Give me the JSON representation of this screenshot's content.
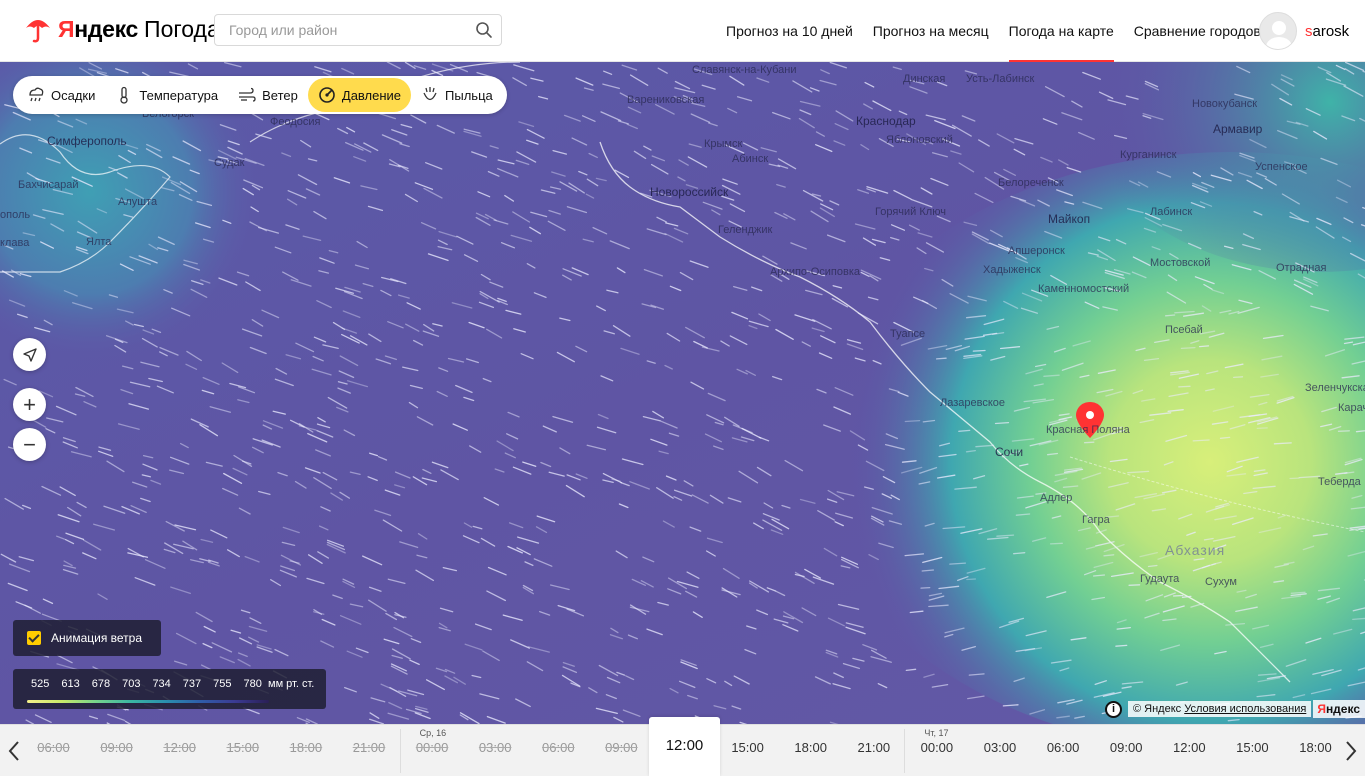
{
  "header": {
    "logo_brand_first": "Я",
    "logo_brand_rest": "ндекс",
    "logo_product": "Погода",
    "search_placeholder": "Город или район",
    "nav": [
      {
        "label": "Прогноз на 10 дней"
      },
      {
        "label": "Прогноз на месяц"
      },
      {
        "label": "Погода на карте"
      },
      {
        "label": "Сравнение городов"
      }
    ],
    "user_first": "s",
    "user_rest": "arosk"
  },
  "layers": [
    {
      "label": "Осадки",
      "icon": "precipitation-icon"
    },
    {
      "label": "Температура",
      "icon": "thermometer-icon"
    },
    {
      "label": "Ветер",
      "icon": "wind-icon"
    },
    {
      "label": "Давление",
      "icon": "pressure-icon",
      "active": true
    },
    {
      "label": "Пыльца",
      "icon": "pollen-icon"
    }
  ],
  "controls": {
    "zoom_in": "+",
    "zoom_out": "−"
  },
  "map": {
    "labels": {
      "simferopol": "Симферополь",
      "alushta": "Алушта",
      "yalta": "Ялта",
      "bakhchisaray": "Бахчисарай",
      "sevastopol": "ополь",
      "balaklava": "клава",
      "belogorsk": "Белогорск",
      "sudak": "Судак",
      "feodosia": "Феодосия",
      "varenikovskaya": "Варениковская",
      "slavyansk": "Славянск-на-Кубани",
      "dinskaya": "Динская",
      "ust_labinsk": "Усть-Лабинск",
      "novokubansk": "Новокубанск",
      "krasnodar": "Краснодар",
      "yablonovsky": "Яблоновский",
      "armavir": "Армавир",
      "krymsk": "Крымск",
      "abinsk": "Абинск",
      "novorossiysk": "Новороссийск",
      "kurganinsk": "Курганинск",
      "uspenskoe": "Успенское",
      "belorechensk": "Белореченск",
      "goryachy_klyuch": "Горячий Ключ",
      "maikop": "Майкоп",
      "labinsk": "Лабинск",
      "gelendzhik": "Геленджик",
      "dzhubga": "Джубга",
      "arkhipo": "Архипо-Осиповка",
      "apsheronsk": "Апшеронск",
      "khadyzhensk": "Хадыженск",
      "mostovskoy": "Мостовской",
      "otradnaya": "Отрадная",
      "kamennomostsky": "Каменномостский",
      "tuapse": "Туапсе",
      "pskhu": "Псебай",
      "zelenchukskaya": "Зеленчукская",
      "krasnaya_polyana": "Красная Поляна",
      "sochi": "Сочи",
      "lazarevskoe": "Лазаревское",
      "adler": "Адлер",
      "gagra": "Гагра",
      "abkhazia": "Абхазия",
      "gudauta": "Гудаута",
      "sukhum": "Сухум",
      "teberda": "Теберда",
      "karachaevsk": "Карача"
    }
  },
  "animation": {
    "label": "Анимация ветра",
    "checked": true
  },
  "legend": {
    "values": [
      "525",
      "613",
      "678",
      "703",
      "734",
      "737",
      "755",
      "780"
    ],
    "unit": "мм рт. ст."
  },
  "copyright": {
    "info": "i",
    "text": "© Яндекс",
    "terms": "Условия использования",
    "logo_first": "Я",
    "logo_rest": "ндекс"
  },
  "timeline": {
    "items": [
      {
        "time": "06:00",
        "state": "past"
      },
      {
        "time": "09:00",
        "state": "past"
      },
      {
        "time": "12:00",
        "state": "past"
      },
      {
        "time": "15:00",
        "state": "past"
      },
      {
        "time": "18:00",
        "state": "past"
      },
      {
        "time": "21:00",
        "state": "past"
      },
      {
        "time": "00:00",
        "state": "past",
        "day": "Ср, 16"
      },
      {
        "time": "03:00",
        "state": "past"
      },
      {
        "time": "06:00",
        "state": "past"
      },
      {
        "time": "09:00",
        "state": "past"
      },
      {
        "time": "12:00",
        "state": "current"
      },
      {
        "time": "15:00",
        "state": "future"
      },
      {
        "time": "18:00",
        "state": "future"
      },
      {
        "time": "21:00",
        "state": "future"
      },
      {
        "time": "00:00",
        "state": "future",
        "day": "Чт, 17"
      },
      {
        "time": "03:00",
        "state": "future"
      },
      {
        "time": "06:00",
        "state": "future"
      },
      {
        "time": "09:00",
        "state": "future"
      },
      {
        "time": "12:00",
        "state": "future"
      },
      {
        "time": "15:00",
        "state": "future"
      },
      {
        "time": "18:00",
        "state": "future"
      }
    ]
  },
  "colors": {
    "accent": "#ff3333",
    "active_layer": "#ffdb4d",
    "sea_pressure": "#5e58a8",
    "high_pressure": "#d6ee7c"
  }
}
